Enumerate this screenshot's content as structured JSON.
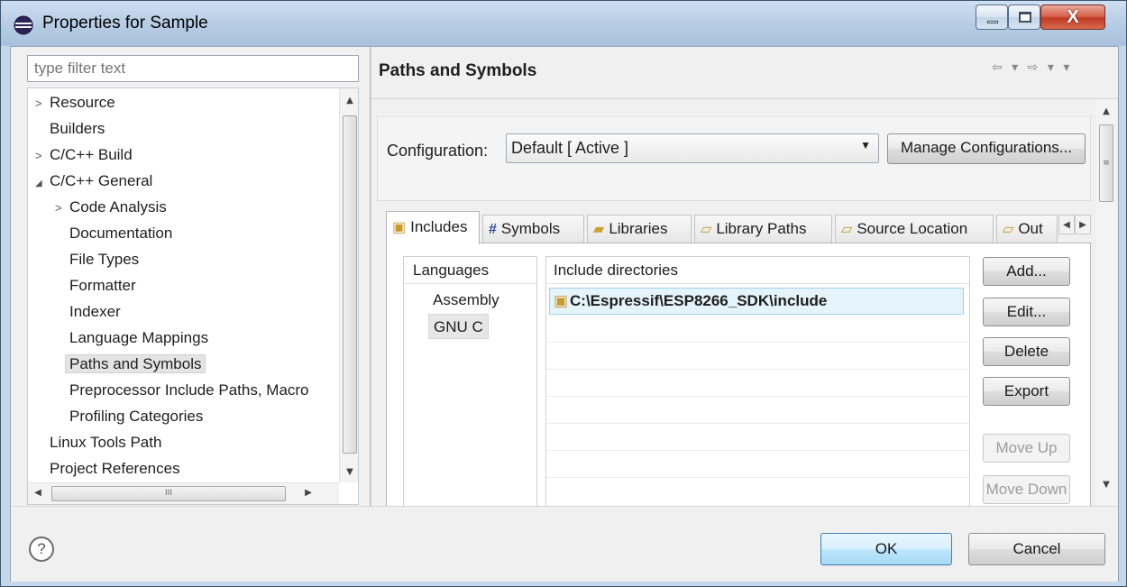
{
  "window": {
    "title": "Properties for Sample",
    "close_glyph": "X"
  },
  "filter": {
    "placeholder": "type filter text"
  },
  "tree": {
    "items": [
      {
        "label": "Resource",
        "arrow": ">"
      },
      {
        "label": "Builders",
        "arrow": ""
      },
      {
        "label": "C/C++ Build",
        "arrow": ">"
      },
      {
        "label": "C/C++ General",
        "arrow": "◢"
      },
      {
        "label": "Code Analysis",
        "arrow": ">"
      },
      {
        "label": "Documentation",
        "arrow": ""
      },
      {
        "label": "File Types",
        "arrow": ""
      },
      {
        "label": "Formatter",
        "arrow": ""
      },
      {
        "label": "Indexer",
        "arrow": ""
      },
      {
        "label": "Language Mappings",
        "arrow": ""
      },
      {
        "label": "Paths and Symbols",
        "arrow": "",
        "selected": true
      },
      {
        "label": "Preprocessor Include Paths, Macro",
        "arrow": ""
      },
      {
        "label": "Profiling Categories",
        "arrow": ""
      },
      {
        "label": "Linux Tools Path",
        "arrow": ""
      },
      {
        "label": "Project References",
        "arrow": ""
      }
    ]
  },
  "page": {
    "title": "Paths and Symbols",
    "nav_arrows": "⇦ ▾ ⇨ ▾ ▾"
  },
  "configuration": {
    "label": "Configuration:",
    "value": "Default  [ Active ]",
    "manage_button": "Manage Configurations..."
  },
  "tabs": [
    {
      "label": "Includes",
      "icon": "📂",
      "active": true
    },
    {
      "label": "Symbols",
      "icon": "#"
    },
    {
      "label": "Libraries",
      "icon": "≡"
    },
    {
      "label": "Library Paths",
      "icon": "📂"
    },
    {
      "label": "Source Location",
      "icon": "📂"
    },
    {
      "label": "Out",
      "icon": "📂"
    }
  ],
  "languages": {
    "header": "Languages",
    "items": [
      "Assembly",
      "GNU C"
    ],
    "selected": "GNU C"
  },
  "include_directories": {
    "header": "Include directories",
    "entries": [
      "C:\\Espressif\\ESP8266_SDK\\include"
    ]
  },
  "side_buttons": {
    "add": "Add...",
    "edit": "Edit...",
    "delete": "Delete",
    "export": "Export",
    "move_up": "Move Up",
    "move_down": "Move Down"
  },
  "footer": {
    "help": "?",
    "ok": "OK",
    "cancel": "Cancel"
  },
  "colors": {
    "titlebar": "#b9cee6",
    "selection_bg": "#e5f3fb",
    "selection_border": "#9fd2ee",
    "ok_border": "#3c7fb1"
  }
}
